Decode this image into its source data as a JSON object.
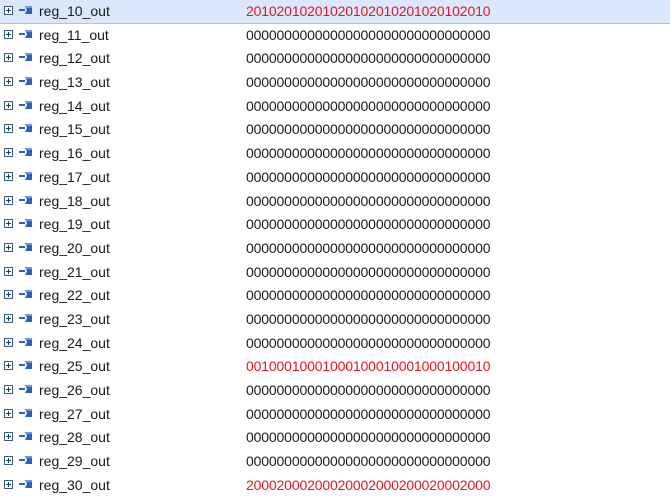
{
  "colors": {
    "selected_row_bg": "#dbe8fb",
    "changed_value": "#e8141e",
    "normal_text": "#1a1a1a"
  },
  "signals": [
    {
      "name": "reg_10_out",
      "value": "20102010201020102010201020102010",
      "changed": true,
      "selected": true,
      "icon": "bus-signal-icon"
    },
    {
      "name": "reg_11_out",
      "value": "00000000000000000000000000000000",
      "changed": false,
      "selected": false,
      "icon": "bus-signal-icon"
    },
    {
      "name": "reg_12_out",
      "value": "00000000000000000000000000000000",
      "changed": false,
      "selected": false,
      "icon": "bus-signal-icon"
    },
    {
      "name": "reg_13_out",
      "value": "00000000000000000000000000000000",
      "changed": false,
      "selected": false,
      "icon": "bus-signal-icon"
    },
    {
      "name": "reg_14_out",
      "value": "00000000000000000000000000000000",
      "changed": false,
      "selected": false,
      "icon": "bus-signal-icon"
    },
    {
      "name": "reg_15_out",
      "value": "00000000000000000000000000000000",
      "changed": false,
      "selected": false,
      "icon": "bus-signal-icon"
    },
    {
      "name": "reg_16_out",
      "value": "00000000000000000000000000000000",
      "changed": false,
      "selected": false,
      "icon": "bus-signal-icon"
    },
    {
      "name": "reg_17_out",
      "value": "00000000000000000000000000000000",
      "changed": false,
      "selected": false,
      "icon": "bus-signal-icon"
    },
    {
      "name": "reg_18_out",
      "value": "00000000000000000000000000000000",
      "changed": false,
      "selected": false,
      "icon": "bus-signal-icon"
    },
    {
      "name": "reg_19_out",
      "value": "00000000000000000000000000000000",
      "changed": false,
      "selected": false,
      "icon": "bus-signal-icon"
    },
    {
      "name": "reg_20_out",
      "value": "00000000000000000000000000000000",
      "changed": false,
      "selected": false,
      "icon": "bus-signal-icon"
    },
    {
      "name": "reg_21_out",
      "value": "00000000000000000000000000000000",
      "changed": false,
      "selected": false,
      "icon": "bus-signal-icon"
    },
    {
      "name": "reg_22_out",
      "value": "00000000000000000000000000000000",
      "changed": false,
      "selected": false,
      "icon": "bus-signal-icon"
    },
    {
      "name": "reg_23_out",
      "value": "00000000000000000000000000000000",
      "changed": false,
      "selected": false,
      "icon": "bus-signal-icon"
    },
    {
      "name": "reg_24_out",
      "value": "00000000000000000000000000000000",
      "changed": false,
      "selected": false,
      "icon": "bus-signal-icon"
    },
    {
      "name": "reg_25_out",
      "value": "00100010001000100010001000100010",
      "changed": true,
      "selected": false,
      "icon": "bus-signal-icon"
    },
    {
      "name": "reg_26_out",
      "value": "00000000000000000000000000000000",
      "changed": false,
      "selected": false,
      "icon": "bus-signal-icon"
    },
    {
      "name": "reg_27_out",
      "value": "00000000000000000000000000000000",
      "changed": false,
      "selected": false,
      "icon": "bus-signal-icon"
    },
    {
      "name": "reg_28_out",
      "value": "00000000000000000000000000000000",
      "changed": false,
      "selected": false,
      "icon": "bus-signal-icon"
    },
    {
      "name": "reg_29_out",
      "value": "00000000000000000000000000000000",
      "changed": false,
      "selected": false,
      "icon": "bus-signal-icon"
    },
    {
      "name": "reg_30_out",
      "value": "20002000200020002000200020002000",
      "changed": true,
      "selected": false,
      "icon": "bus-signal-icon"
    }
  ]
}
